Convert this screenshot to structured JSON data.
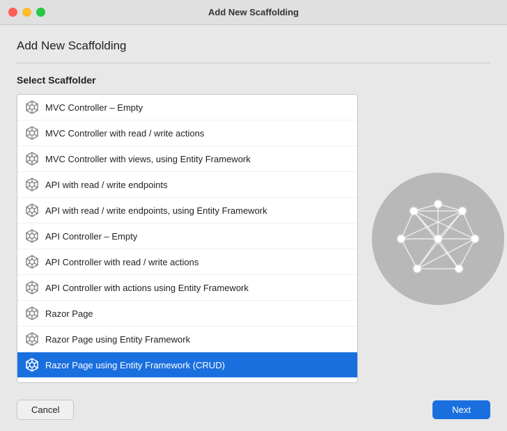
{
  "window": {
    "title": "Add New Scaffolding",
    "heading": "Add New Scaffolding",
    "section_label": "Select Scaffolder"
  },
  "buttons": {
    "cancel": "Cancel",
    "next": "Next"
  },
  "scaffolders": [
    {
      "id": 1,
      "label": "MVC Controller – Empty",
      "selected": false
    },
    {
      "id": 2,
      "label": "MVC Controller with read / write actions",
      "selected": false
    },
    {
      "id": 3,
      "label": "MVC Controller with views, using Entity Framework",
      "selected": false
    },
    {
      "id": 4,
      "label": "API with read / write endpoints",
      "selected": false
    },
    {
      "id": 5,
      "label": "API with read / write endpoints, using Entity Framework",
      "selected": false
    },
    {
      "id": 6,
      "label": "API Controller – Empty",
      "selected": false
    },
    {
      "id": 7,
      "label": "API Controller with read / write actions",
      "selected": false
    },
    {
      "id": 8,
      "label": "API Controller with actions using Entity Framework",
      "selected": false
    },
    {
      "id": 9,
      "label": "Razor Page",
      "selected": false
    },
    {
      "id": 10,
      "label": "Razor Page using Entity Framework",
      "selected": false
    },
    {
      "id": 11,
      "label": "Razor Page using Entity Framework (CRUD)",
      "selected": true
    }
  ]
}
